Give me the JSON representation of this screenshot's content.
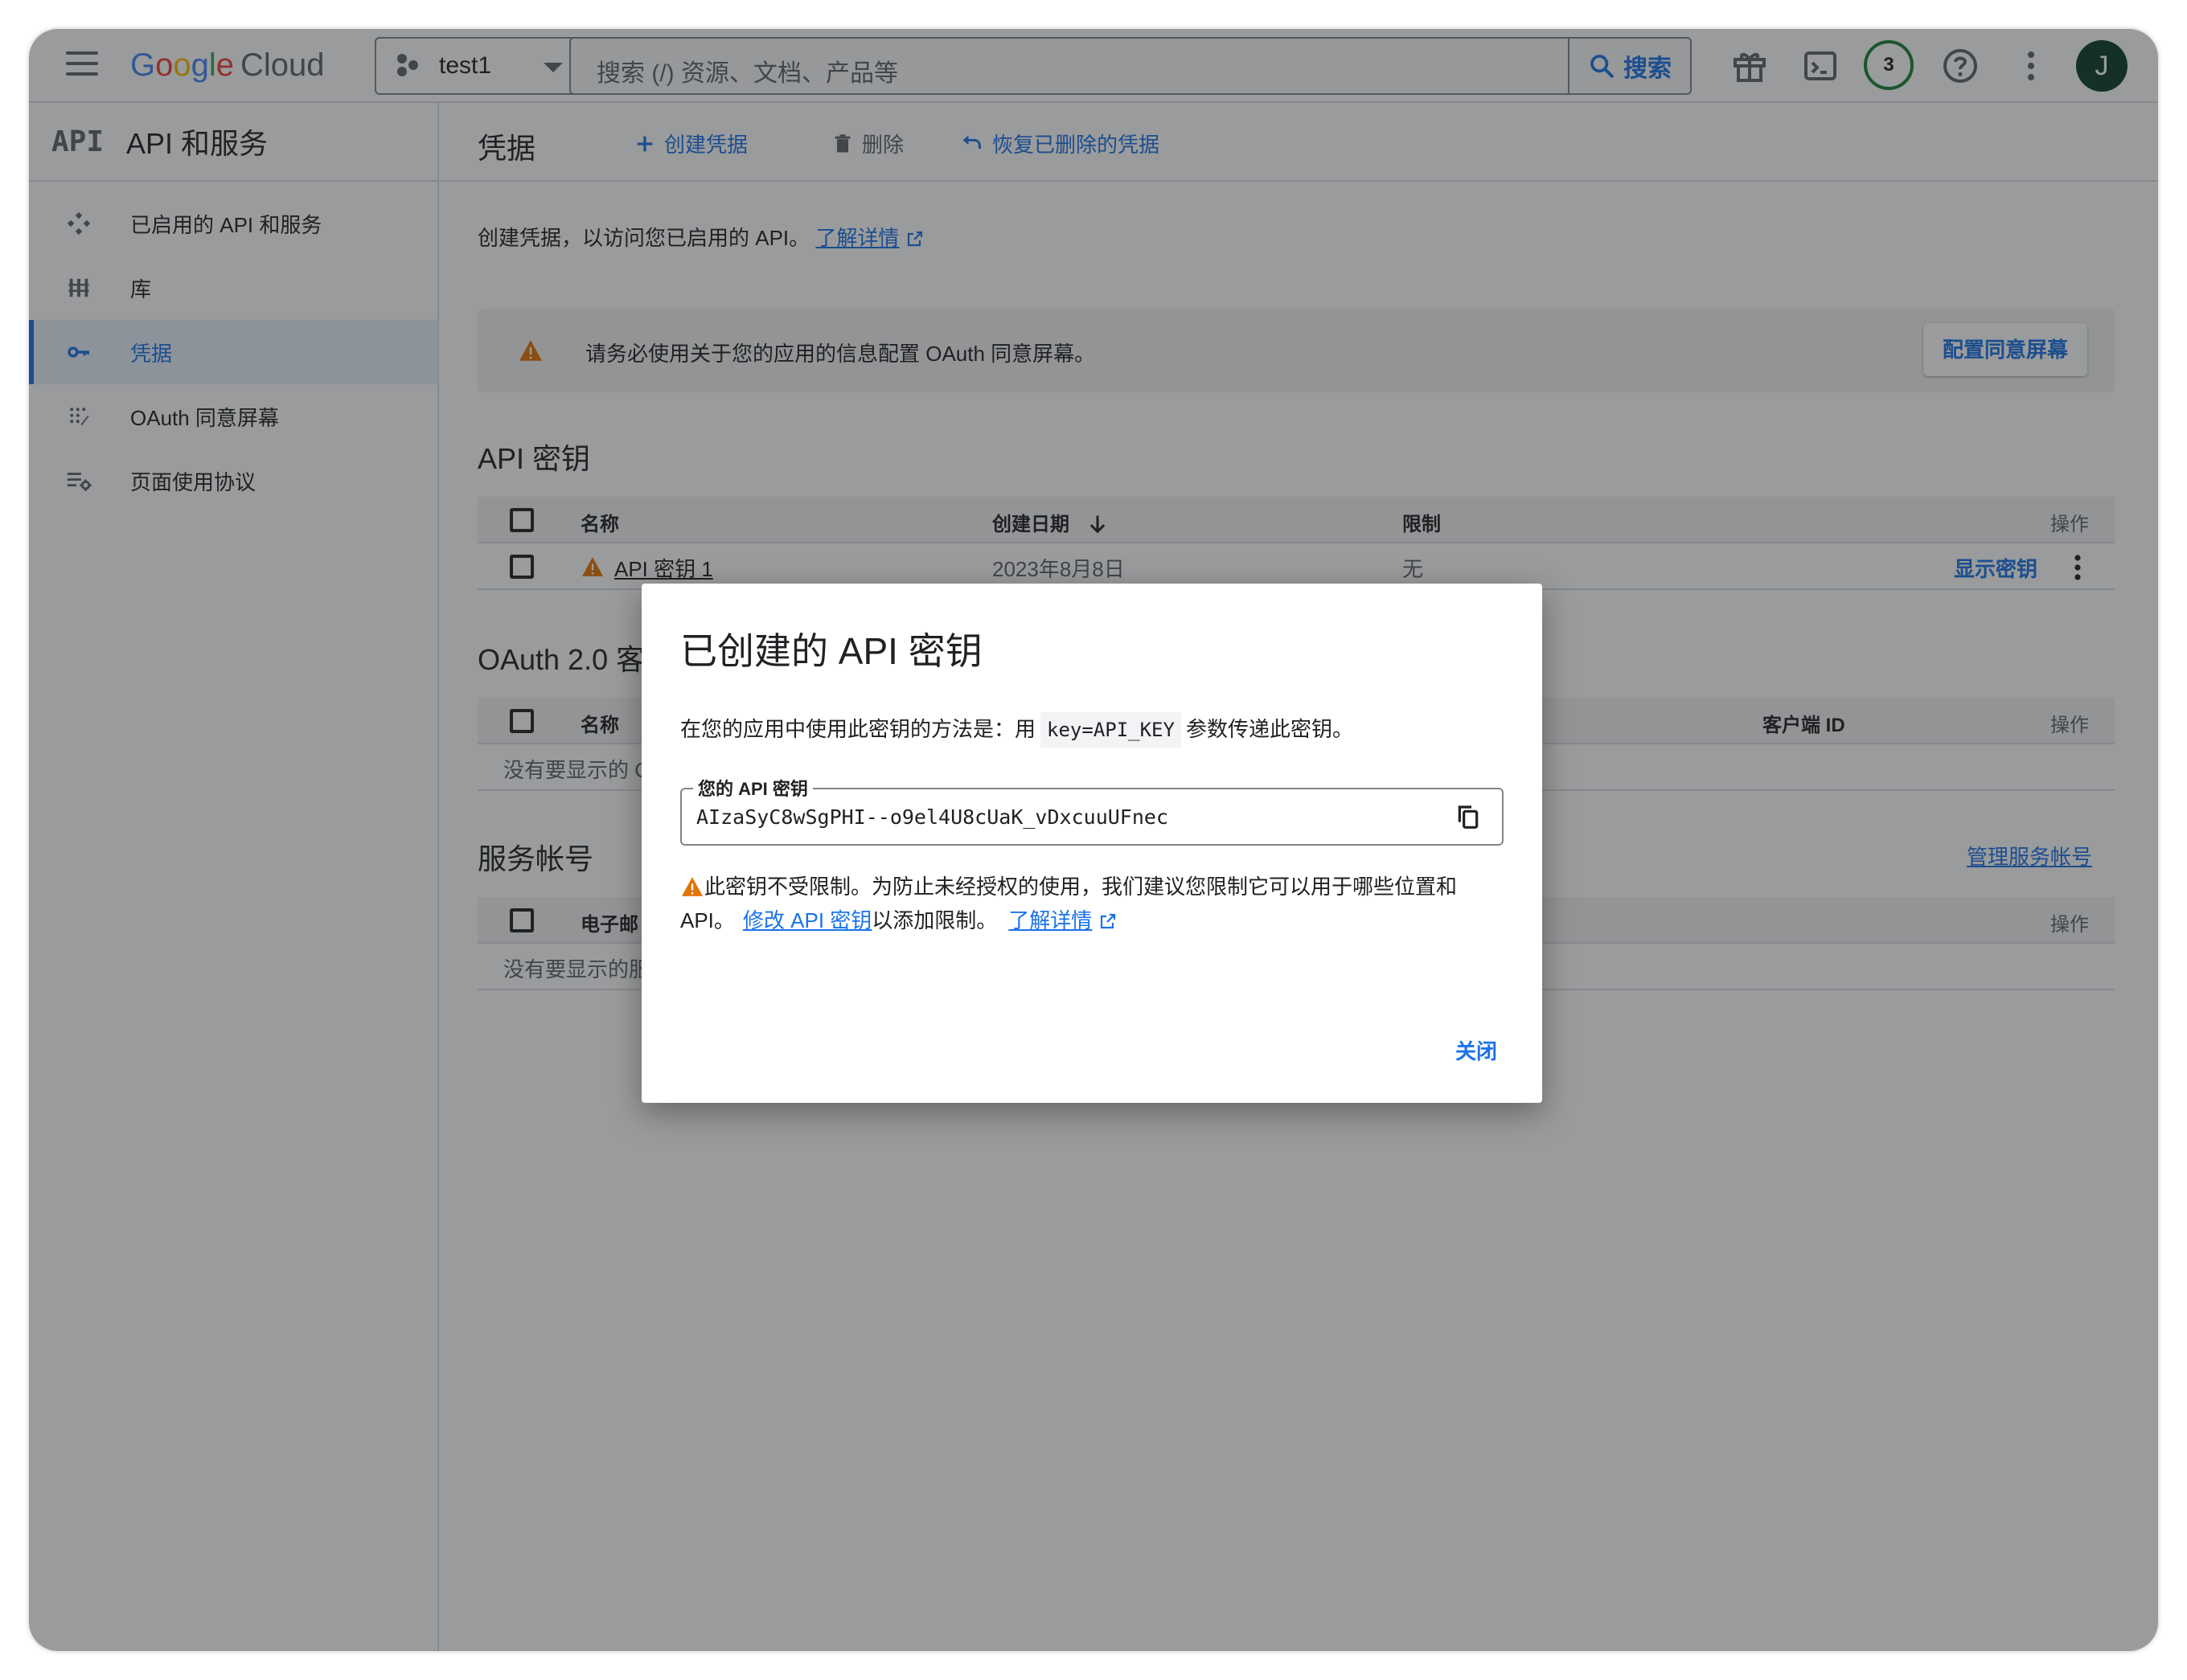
{
  "topbar": {
    "logo_google": [
      "G",
      "o",
      "o",
      "g",
      "l",
      "e"
    ],
    "logo_cloud": "Cloud",
    "project": "test1",
    "search_placeholder": "搜索 (/) 资源、文档、产品等",
    "search_button": "搜索",
    "notification_count": "3",
    "avatar_initial": "J"
  },
  "sidebar": {
    "product_mark": "API",
    "title": "API 和服务",
    "items": [
      {
        "label": "已启用的 API 和服务",
        "icon": "api-services-icon"
      },
      {
        "label": "库",
        "icon": "library-icon"
      },
      {
        "label": "凭据",
        "icon": "key-icon"
      },
      {
        "label": "OAuth 同意屏幕",
        "icon": "oauth-consent-icon"
      },
      {
        "label": "页面使用协议",
        "icon": "page-usage-icon"
      }
    ],
    "collapse_glyph": "<I"
  },
  "main": {
    "page_title": "凭据",
    "create_label": "创建凭据",
    "delete_label": "删除",
    "restore_label": "恢复已删除的凭据",
    "intro_text": "创建凭据，以访问您已启用的 API。",
    "intro_link": "了解详情",
    "banner_text": "请务必使用关于您的应用的信息配置 OAuth 同意屏幕。",
    "banner_button": "配置同意屏幕",
    "api_keys": {
      "title": "API 密钥",
      "col_name": "名称",
      "col_date": "创建日期",
      "col_limit": "限制",
      "col_actions": "操作",
      "row": {
        "name": "API 密钥 1",
        "date": "2023年8月8日",
        "limit": "无",
        "action": "显示密钥"
      }
    },
    "oauth": {
      "title": "OAuth 2.0 客",
      "col_name": "名称",
      "col_client": "客户端 ID",
      "col_actions": "操作",
      "empty": "没有要显示的 O"
    },
    "service_accounts": {
      "title": "服务帐号",
      "manage_link": "管理服务帐号",
      "col_email": "电子邮",
      "col_actions": "操作",
      "empty": "没有要显示的服"
    }
  },
  "dialog": {
    "title": "已创建的 API 密钥",
    "desc_before": "在您的应用中使用此密钥的方法是：用",
    "desc_code": "key=API_KEY",
    "desc_after": "参数传递此密钥。",
    "field_label": "您的 API 密钥",
    "field_value": "AIzaSyC8wSgPHI--o9el4U8cUaK_vDxcuuUFnec",
    "warn_text": "此密钥不受限制。为防止未经授权的使用，我们建议您限制它可以用于哪些位置和 API。",
    "warn_link1": "修改 API 密钥",
    "warn_mid": "以添加限制。",
    "warn_link2": "了解详情",
    "close_label": "关闭"
  },
  "colors": {
    "accent": "#1a73e8",
    "warning": "#e37400",
    "badge_ring": "#188038",
    "avatar_bg": "#0b3d2e"
  }
}
